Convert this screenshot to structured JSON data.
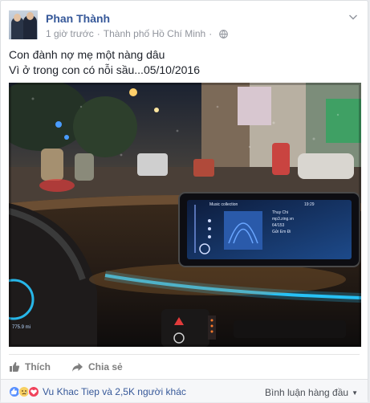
{
  "post": {
    "author": "Phan Thành",
    "time": "1 giờ trước",
    "separator": "·",
    "location": "Thành phố Hồ Chí Minh",
    "text_line1": "Con đành nợ mẹ một nàng dâu",
    "text_line2": "Vì ở trong con có nỗi sầu...05/10/2016",
    "photo_screen": {
      "title": "Music collection",
      "clock": "19:29",
      "track_artist": "Thuy Chi",
      "track_source": "mp3.zing.vn",
      "track_count": "64/153",
      "track_title": "Gửi Em Đi",
      "odometer": "775.9 mi"
    }
  },
  "actions": {
    "like_label": "Thích",
    "share_label": "Chia sẻ"
  },
  "footer": {
    "reactions_text": "Vu Khac Tiep và 2,5K người khác",
    "comment_order_label": "Bình luận hàng đầu"
  },
  "colors": {
    "author_link": "#365899",
    "meta_text": "#90949c",
    "ambient_light": "#28c8ff",
    "like_blue": "#5890ff",
    "love_red": "#f0425b",
    "sad_yellow": "#f7d063"
  },
  "icons": [
    "chevron-down-icon",
    "globe-icon",
    "thumbs-up-icon",
    "share-arrow-icon",
    "like-react-icon",
    "sad-react-icon",
    "love-react-icon"
  ]
}
